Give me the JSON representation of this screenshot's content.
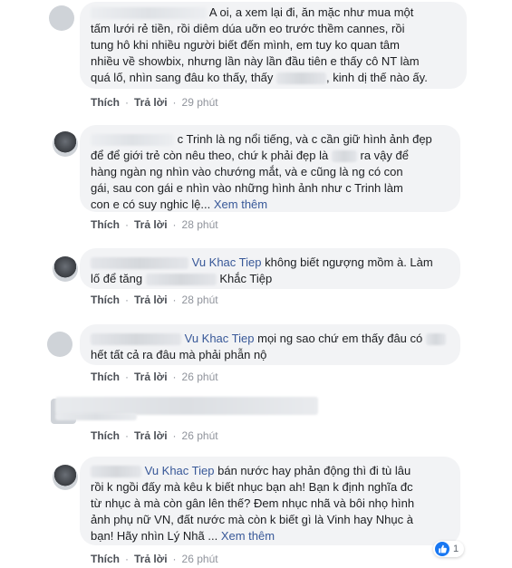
{
  "labels": {
    "like": "Thích",
    "reply": "Trả lời",
    "see_more": "Xem thêm",
    "reaction_count": "1"
  },
  "colors": {
    "bubble": "#f2f3f5",
    "link": "#385898",
    "meta": "#90949c",
    "like_badge": "#1877f2"
  },
  "comments": [
    {
      "lines": [
        "A oi, a xem lại đi, ăn mặc như mua một",
        "tấm lưới rẻ tiền, rồi diêm dúa uỡn eo trước thềm cannes, rồi",
        "tung hô khi nhiều người biết đến mình, em tuy ko quan tâm",
        "nhiều về showbix, nhưng lần này lần đầu tiên e thấy cô NT làm",
        "quá lố, nhìn sang đâu ko thấy, thấy",
        ", kinh dị thế nào ấy."
      ],
      "time": "29 phút"
    },
    {
      "lines": [
        "c Trinh là ng nổi tiếng, và c cần giữ hình ảnh đẹp",
        "để để giới trẻ còn nêu theo, chứ k phải đẹp là",
        "ra vậy để",
        "hàng ngàn ng nhìn vào chướng mắt, và e cũng là ng có con",
        "gái, sau con gái e nhìn vào những hình ảnh như c Trinh làm",
        "con e có suy nghic lệ..."
      ],
      "time": "28 phút"
    },
    {
      "name": "Vu Khac Tiep",
      "lines": [
        "không biết ngượng mồm à. Làm",
        "lố để tăng",
        "Khắc Tiệp"
      ],
      "time": "28 phút"
    },
    {
      "name": "Vu Khac Tiep",
      "lines": [
        "mọi ng sao chứ em thấy đâu có",
        "hết tất cả ra đâu mà phải phẫn nộ"
      ],
      "time": "26 phút"
    },
    {
      "lines": [],
      "time": "26 phút"
    },
    {
      "name": "Vu Khac Tiep",
      "lines": [
        "bán nước hay phản động thì đi tù lâu",
        "rồi k ngồi đấy mà kêu k biết nhục bạn ah! Bạn k định nghĩa đc",
        "từ nhục à mà còn gân lên thế? Đem nhục nhã và bôi nhọ hình",
        "ảnh phụ nữ VN, đất nước mà còn k biết gì là Vinh hay Nhục à",
        "bạn! Hãy nhìn Lý Nhã ..."
      ],
      "time": "26 phút"
    }
  ]
}
